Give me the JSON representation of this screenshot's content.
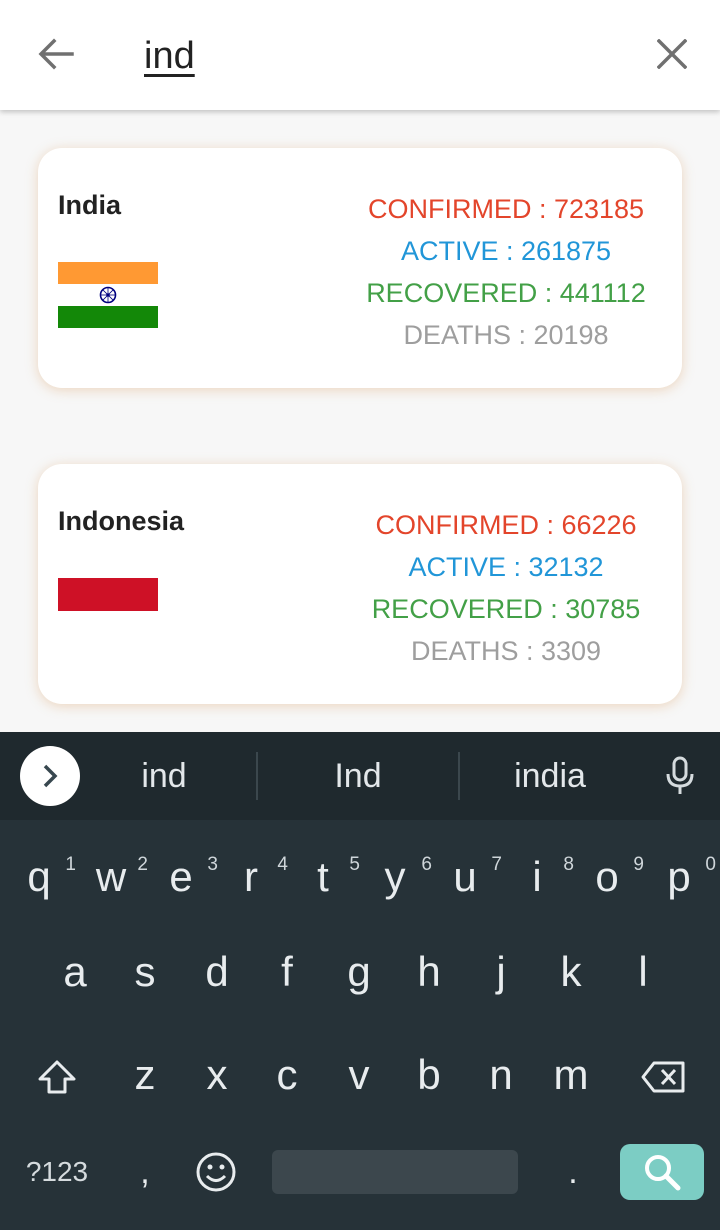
{
  "search": {
    "query": "ind"
  },
  "icons": {
    "back": "arrow-left-icon",
    "clear": "close-icon"
  },
  "results": [
    {
      "country": "India",
      "flag": "india-flag",
      "confirmed": "CONFIRMED : 723185",
      "active": "ACTIVE : 261875",
      "recovered": "RECOVERED : 441112",
      "deaths": "DEATHS : 20198"
    },
    {
      "country": "Indonesia",
      "flag": "indonesia-flag",
      "confirmed": "CONFIRMED : 66226",
      "active": "ACTIVE : 32132",
      "recovered": "RECOVERED : 30785",
      "deaths": "DEATHS : 3309"
    }
  ],
  "colors": {
    "confirmed": "#e3452b",
    "active": "#2196d8",
    "recovered": "#43a047",
    "deaths": "#9e9e9e",
    "keyboard_bg": "#263238",
    "search_key": "#7ccdc4"
  },
  "keyboard": {
    "suggestions": [
      "ind",
      "Ind",
      "india"
    ],
    "row1": [
      "q",
      "w",
      "e",
      "r",
      "t",
      "y",
      "u",
      "i",
      "o",
      "p"
    ],
    "row1_numbers": [
      "1",
      "2",
      "3",
      "4",
      "5",
      "6",
      "7",
      "8",
      "9",
      "0"
    ],
    "row2": [
      "a",
      "s",
      "d",
      "f",
      "g",
      "h",
      "j",
      "k",
      "l"
    ],
    "row3": [
      "z",
      "x",
      "c",
      "v",
      "b",
      "n",
      "m"
    ],
    "symbols_label": "?123",
    "comma": ",",
    "period": "."
  }
}
